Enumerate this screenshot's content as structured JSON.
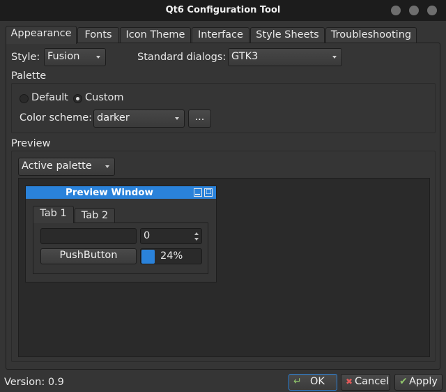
{
  "window": {
    "title": "Qt6 Configuration Tool"
  },
  "tabs": [
    "Appearance",
    "Fonts",
    "Icon Theme",
    "Interface",
    "Style Sheets",
    "Troubleshooting"
  ],
  "appearance": {
    "style_label": "Style:",
    "style_value": "Fusion",
    "dialogs_label": "Standard dialogs:",
    "dialogs_value": "GTK3",
    "palette_label": "Palette",
    "radio_default": "Default",
    "radio_custom": "Custom",
    "radio_selected": "Custom",
    "scheme_label": "Color scheme:",
    "scheme_value": "darker",
    "more_button": "...",
    "preview_label": "Preview",
    "palette_select": "Active palette"
  },
  "preview_window": {
    "title": "Preview Window",
    "minimize_icon": "▁",
    "maximize_icon": "□",
    "tab1": "Tab 1",
    "tab2": "Tab 2",
    "spin_value": "0",
    "push_button": "PushButton",
    "progress_text": "24%",
    "progress_value": 0.24
  },
  "footer": {
    "version": "Version: 0.9",
    "ok": "OK",
    "ok_icon": "↵",
    "cancel": "Cancel",
    "cancel_icon": "✖",
    "apply": "Apply",
    "apply_icon": "✔"
  },
  "colors": {
    "accent": "#2a82da",
    "background": "#353535",
    "titlebar": "#1c1c1c"
  }
}
